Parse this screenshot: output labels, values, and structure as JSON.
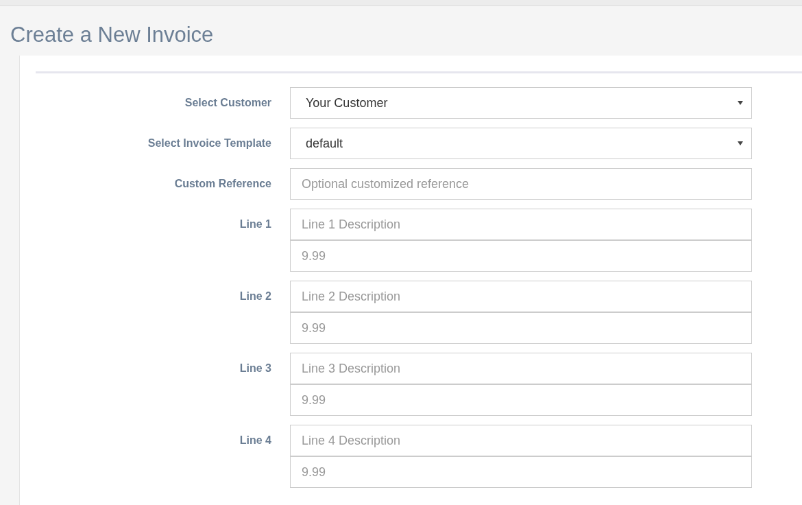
{
  "page_title": "Create a New Invoice",
  "rows": [
    {
      "kind": "select",
      "label": "Select Customer",
      "value": "Your Customer"
    },
    {
      "kind": "select",
      "label": "Select Invoice Template",
      "value": "default"
    },
    {
      "kind": "text",
      "label": "Custom Reference",
      "placeholder": "Optional customized reference"
    },
    {
      "kind": "line",
      "label": "Line 1",
      "description_placeholder": "Line 1 Description",
      "amount_placeholder": "9.99"
    },
    {
      "kind": "line",
      "label": "Line 2",
      "description_placeholder": "Line 2 Description",
      "amount_placeholder": "9.99"
    },
    {
      "kind": "line",
      "label": "Line 3",
      "description_placeholder": "Line 3 Description",
      "amount_placeholder": "9.99"
    },
    {
      "kind": "line",
      "label": "Line 4",
      "description_placeholder": "Line 4 Description",
      "amount_placeholder": "9.99"
    }
  ]
}
